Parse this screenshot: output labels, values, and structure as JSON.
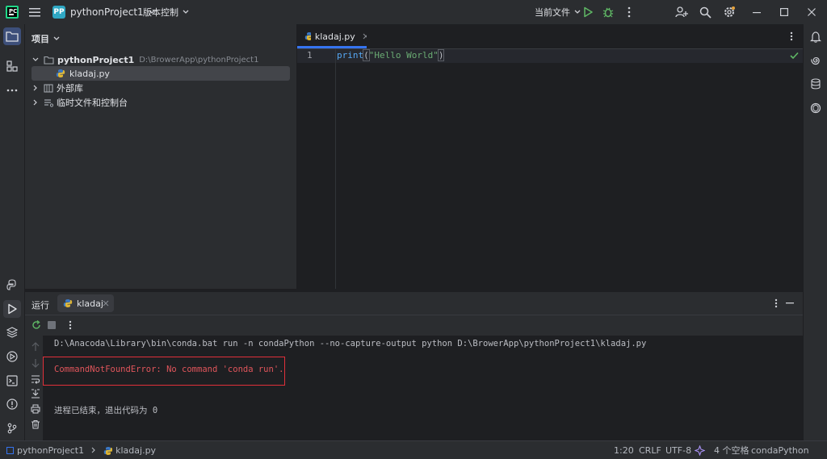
{
  "colors": {
    "accent": "#3574f0",
    "error": "#e0555b",
    "run_green": "#5fb865",
    "folder": "#a1a6ad"
  },
  "titlebar": {
    "logo_icon": "pycharm-logo",
    "project_badge": "PP",
    "project_name": "pythonProject1",
    "vcs_label": "版本控制",
    "run_config": "当前文件"
  },
  "project_panel": {
    "title": "项目",
    "tree": [
      {
        "label": "pythonProject1",
        "path": "D:\\BrowerApp\\pythonProject1"
      },
      {
        "label": "kladaj.py"
      },
      {
        "label": "外部库"
      },
      {
        "label": "临时文件和控制台"
      }
    ]
  },
  "editor": {
    "tab_label": "kladaj.py",
    "line_number": "1",
    "code": {
      "fn": "print",
      "open": "(",
      "str": "\"Hello World\"",
      "close": ")"
    }
  },
  "run_panel": {
    "title": "运行",
    "tab_label": "kladaj",
    "command": "D:\\Anacoda\\Library\\bin\\conda.bat run -n condaPython --no-capture-output python D:\\BrowerApp\\pythonProject1\\kladaj.py",
    "error": "CommandNotFoundError: No command 'conda run'.",
    "exit": "进程已结束，退出代码为 0"
  },
  "statusbar": {
    "crumb_project": "pythonProject1",
    "crumb_file": "kladaj.py",
    "position": "1:20",
    "line_sep": "CRLF",
    "encoding": "UTF-8",
    "indent": "4 个空格",
    "interpreter": "condaPython"
  }
}
